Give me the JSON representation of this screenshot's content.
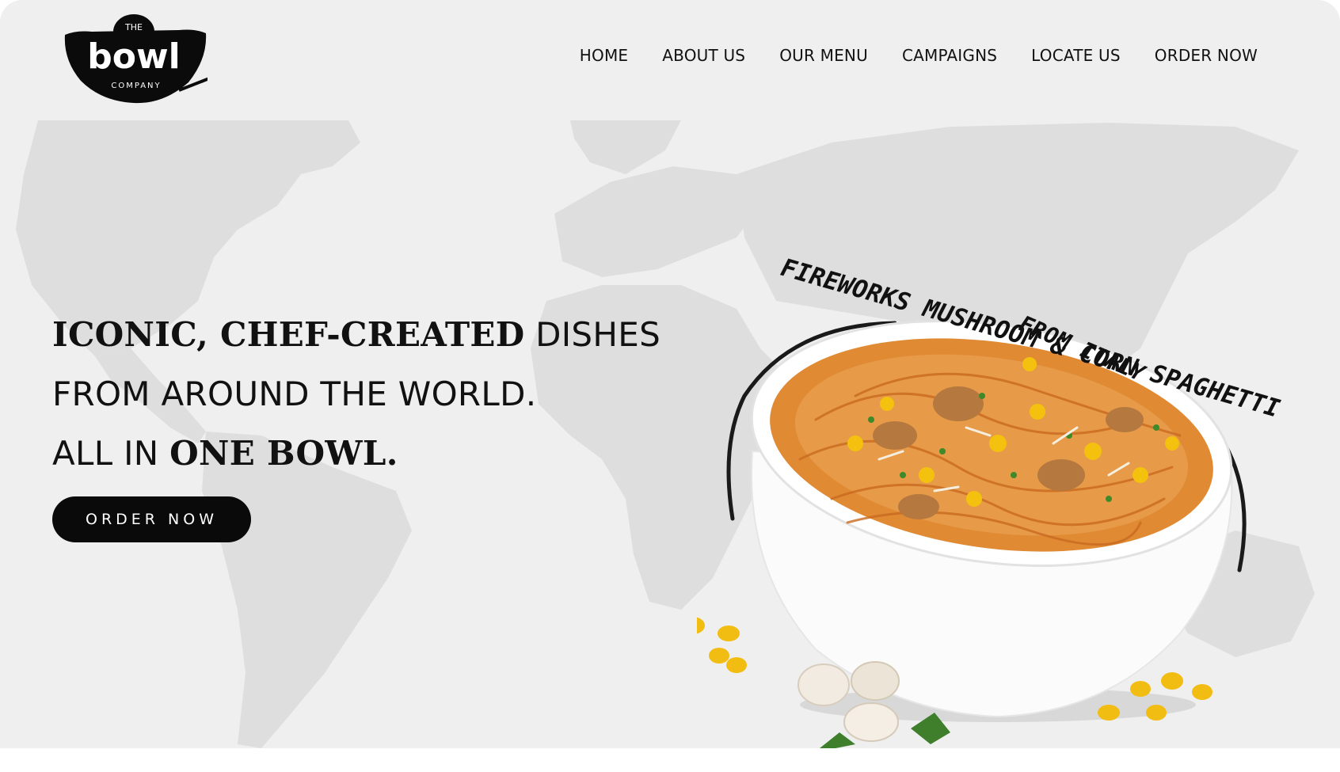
{
  "brand": {
    "logo_top": "THE",
    "logo_main": "bowl",
    "logo_bottom": "COMPANY"
  },
  "nav": {
    "items": [
      "HOME",
      "ABOUT US",
      "OUR MENU",
      "CAMPAIGNS",
      "LOCATE US",
      "ORDER NOW"
    ]
  },
  "hero": {
    "line1_bold": "ICONIC, CHEF-CREATED",
    "line1_regular": " DISHES",
    "line2": "FROM AROUND THE WORLD.",
    "line3_regular": "ALL IN ",
    "line3_bold": "ONE BOWL.",
    "cta_label": "ORDER NOW"
  },
  "dish": {
    "name": "FIREWORKS MUSHROOM & CORN SPAGHETTI",
    "origin": "FROM ITALY"
  },
  "colors": {
    "background": "#efefef",
    "map": "#dedede",
    "text": "#111111",
    "button": "#0a0a0a"
  }
}
